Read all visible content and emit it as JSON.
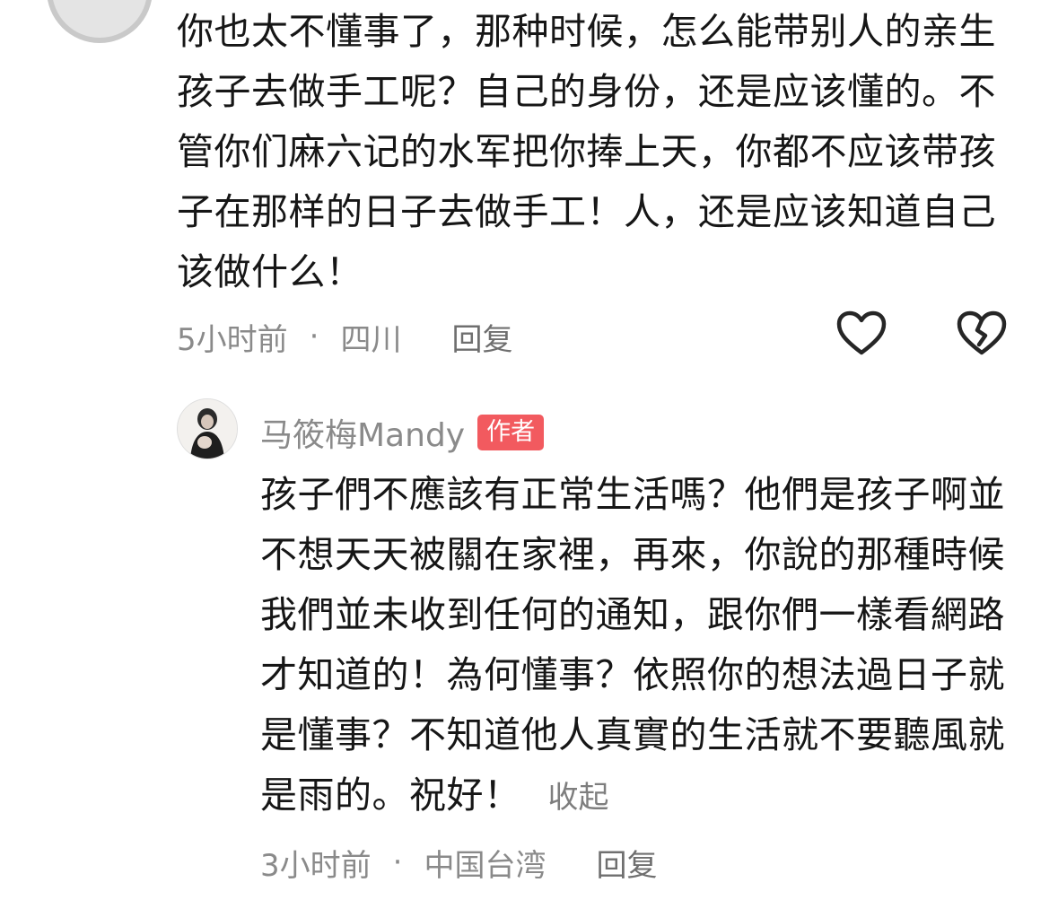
{
  "top_comment": {
    "text": "你也太不懂事了，那种时候，怎么能带别人的亲生孩子去做手工呢？自己的身份，还是应该懂的。不管你们麻六记的水军把你捧上天，你都不应该带孩子在那样的日子去做手工！人，还是应该知道自己该做什么！",
    "time": "5小时前",
    "dot": "·",
    "location": "四川",
    "reply_label": "回复",
    "like_icon": "heart-outline-icon",
    "dislike_icon": "broken-heart-icon"
  },
  "author_reply": {
    "name": "马筱梅Mandy",
    "badge": "作者",
    "text": "孩子們不應該有正常生活嗎？他們是孩子啊並不想天天被關在家裡，再來，你說的那種時候我們並未收到任何的通知，跟你們一樣看網路才知道的！為何懂事？依照你的想法過日子就是懂事？不知道他人真實的生活就不要聽風就是雨的。祝好！",
    "collapse_label": "收起",
    "time": "3小时前",
    "dot": "·",
    "location": "中国台湾",
    "reply_label": "回复"
  },
  "colors": {
    "text": "#161616",
    "meta": "#8a8a8a",
    "badge": "#f25a5f"
  }
}
